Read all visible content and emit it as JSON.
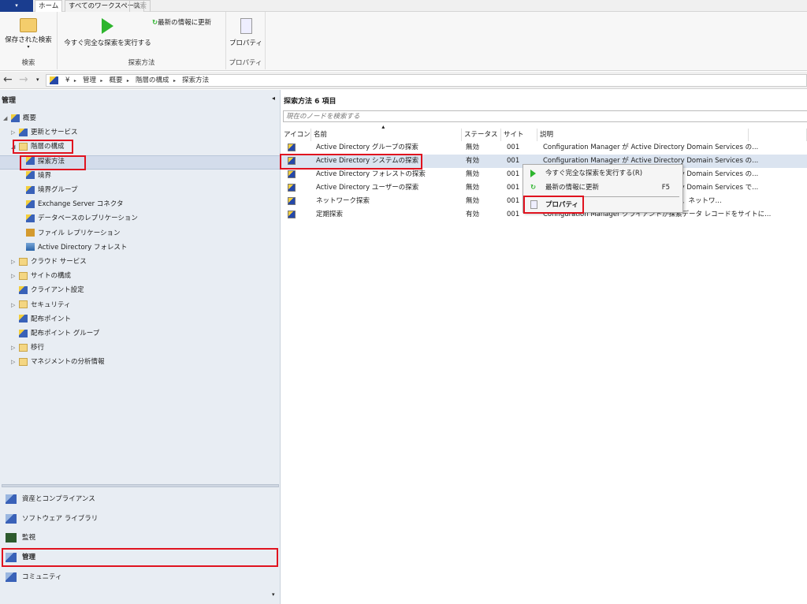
{
  "tabs": {
    "app_menu": "▾",
    "home": "ホーム",
    "all_workspaces": "すべてのワークスペース",
    "search": "検索"
  },
  "ribbon": {
    "saved_searches": "保存された検索",
    "saved_searches_arrow": "▾",
    "group_search": "検索",
    "run_full_discovery": "今すぐ完全な探索を実行する",
    "refresh": "最新の情報に更新",
    "group_discovery": "探索方法",
    "properties": "プロパティ",
    "group_properties": "プロパティ"
  },
  "address": {
    "back": "←",
    "forward": "→",
    "dropdown": "▾",
    "crumbs": [
      "¥",
      "管理",
      "概要",
      "階層の構成",
      "探索方法"
    ],
    "sep": "▸"
  },
  "left": {
    "title": "管理",
    "collapse": "◂",
    "tree": [
      {
        "label": "概要"
      },
      {
        "label": "更新とサービス"
      },
      {
        "label": "階層の構成"
      },
      {
        "label": "探索方法"
      },
      {
        "label": "境界"
      },
      {
        "label": "境界グループ"
      },
      {
        "label": "Exchange Server コネクタ"
      },
      {
        "label": "データベースのレプリケーション"
      },
      {
        "label": "ファイル レプリケーション"
      },
      {
        "label": "Active Directory フォレスト"
      },
      {
        "label": "クラウド サービス"
      },
      {
        "label": "サイトの構成"
      },
      {
        "label": "クライアント設定"
      },
      {
        "label": "セキュリティ"
      },
      {
        "label": "配布ポイント"
      },
      {
        "label": "配布ポイント グループ"
      },
      {
        "label": "移行"
      },
      {
        "label": "マネジメントの分析情報"
      }
    ],
    "workspaces": [
      {
        "label": "資産とコンプライアンス"
      },
      {
        "label": "ソフトウェア ライブラリ"
      },
      {
        "label": "監視"
      },
      {
        "label": "管理"
      },
      {
        "label": "コミュニティ"
      }
    ],
    "scroll_down": "▾"
  },
  "main": {
    "title": "探索方法 6 項目",
    "search_placeholder": "現在のノードを検索する",
    "columns": [
      "アイコン",
      "名前",
      "ステータス",
      "サイト",
      "説明"
    ],
    "rows": [
      {
        "name": "Active Directory グループの探索",
        "status": "無効",
        "site": "001",
        "desc": "Configuration Manager が Active Directory Domain Services の..."
      },
      {
        "name": "Active Directory システムの探索",
        "status": "有効",
        "site": "001",
        "desc": "Configuration Manager が Active Directory Domain Services の..."
      },
      {
        "name": "Active Directory フォレストの探索",
        "status": "無効",
        "site": "001",
        "desc": "Configuration Manager が Active Directory Domain Services の..."
      },
      {
        "name": "Active Directory ユーザーの探索",
        "status": "無効",
        "site": "001",
        "desc": "Configuration Manager が Active Directory Domain Services で..."
      },
      {
        "name": "ネットワーク探索",
        "status": "無効",
        "site": "001",
        "desc": "Configuration Manager がクライアントなど、ネットワ..."
      },
      {
        "name": "定期探索",
        "status": "有効",
        "site": "001",
        "desc": "Configuration Manager クライアントが探索データ レコードをサイトに..."
      }
    ]
  },
  "context_menu": {
    "run": "今すぐ完全な探索を実行する(R)",
    "refresh": "最新の情報に更新",
    "refresh_shortcut": "F5",
    "properties": "プロパティ"
  },
  "colors": {
    "highlight": "#e0131f",
    "accent": "#1a3d8f",
    "selected_row": "#dbe4f0"
  }
}
